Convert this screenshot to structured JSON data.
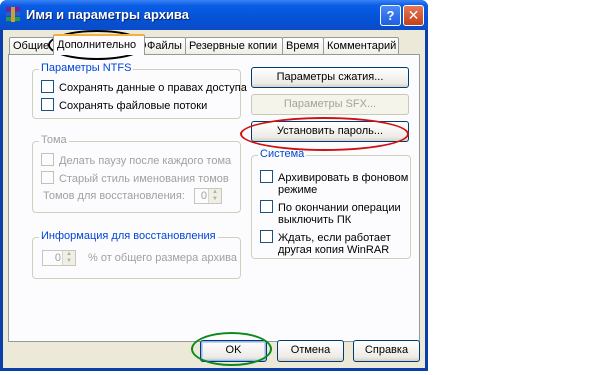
{
  "window": {
    "title": "Имя и параметры архива",
    "help_label": "?",
    "close_label": "✕"
  },
  "tabs": [
    {
      "label": "Общие"
    },
    {
      "label": "Дополнительно",
      "active": true
    },
    {
      "label": "Файлы"
    },
    {
      "label": "Резервные копии"
    },
    {
      "label": "Время"
    },
    {
      "label": "Комментарий"
    }
  ],
  "ntfs": {
    "label": "Параметры NTFS",
    "options": [
      {
        "label": "Сохранять данные о правах доступа",
        "checked": false
      },
      {
        "label": "Сохранять файловые потоки",
        "checked": false
      }
    ]
  },
  "volumes": {
    "label": "Тома",
    "options": [
      {
        "label": "Делать паузу после каждого тома",
        "enabled": false
      },
      {
        "label": "Старый стиль именования томов",
        "enabled": false
      }
    ],
    "recovery_volumes_label": "Томов для восстановления:",
    "recovery_volumes_value": "0"
  },
  "recovery": {
    "label": "Информация для восстановления",
    "value": "0",
    "suffix": "% от общего размера архива"
  },
  "buttons": {
    "compression": "Параметры сжатия...",
    "sfx": "Параметры SFX...",
    "password": "Установить пароль..."
  },
  "system": {
    "label": "Система",
    "options": [
      {
        "label_line1": "Архивировать в фоновом",
        "label_line2": "режиме",
        "checked": false
      },
      {
        "label_line1": "По окончании операции",
        "label_line2": "выключить ПК",
        "checked": false
      },
      {
        "label_line1": "Ждать, если работает",
        "label_line2": "другая копия WinRAR",
        "checked": false
      }
    ]
  },
  "dialog_buttons": {
    "ok": "OK",
    "cancel": "Отмена",
    "help": "Справка"
  },
  "annotations": {
    "tab_highlight_color": "#000000",
    "password_highlight_color": "#d01010",
    "ok_highlight_color": "#0a8a1a"
  }
}
